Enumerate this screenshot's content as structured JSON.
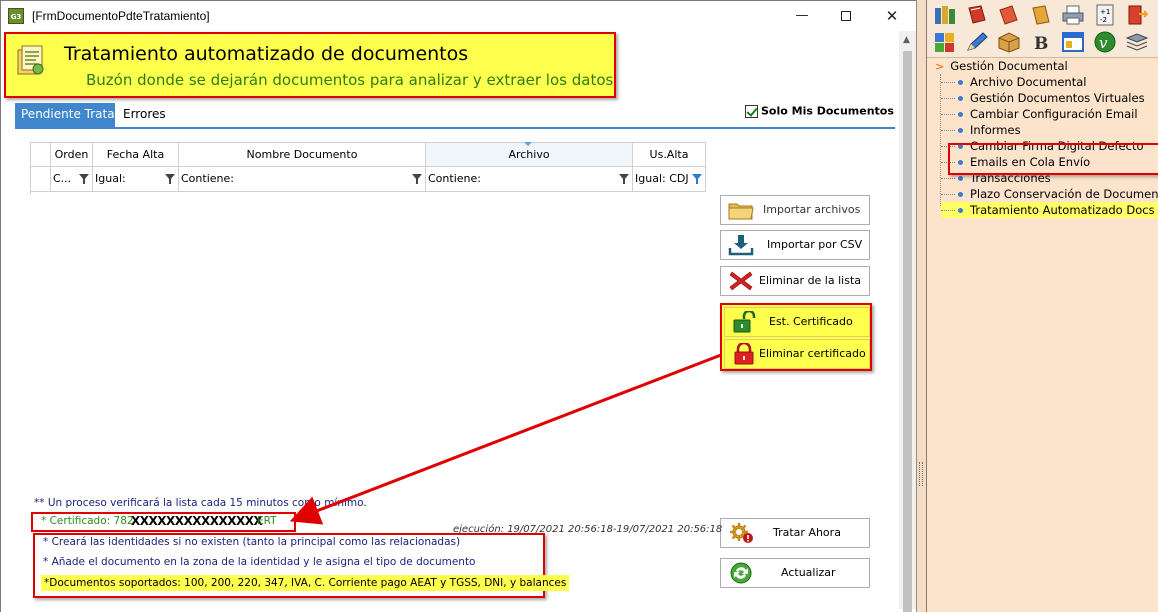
{
  "window": {
    "app_icon_text": "G3",
    "title": "[FrmDocumentoPdteTratamiento]",
    "min_glyph": "—",
    "close_glyph": "✕"
  },
  "banner": {
    "icon": "document-inbox-icon",
    "title": "Tratamiento automatizado de documentos",
    "subtitle": "Buzón donde se dejarán documentos para analizar y extraer los datos"
  },
  "tabs": [
    {
      "label": "Pendiente Tratar",
      "active": true
    },
    {
      "label": "Errores",
      "active": false
    }
  ],
  "only_mine": {
    "label": "Solo Mis Documentos",
    "checked": true
  },
  "grid": {
    "columns": [
      {
        "header": "",
        "filter": ""
      },
      {
        "header": "Orden",
        "filter": "C..."
      },
      {
        "header": "Fecha Alta",
        "filter": "Igual:"
      },
      {
        "header": "Nombre Documento",
        "filter": "Contiene:"
      },
      {
        "header": "Archivo",
        "filter": "Contiene:"
      },
      {
        "header": "Us.Alta",
        "filter": "Igual: CDJ"
      }
    ]
  },
  "actions": {
    "import_files": "Importar archivos",
    "import_csv": "Importar por CSV",
    "delete_from_list": "Eliminar de la lista",
    "cert_status": "Est. Certificado",
    "delete_cert": "Eliminar certificado",
    "process_now": "Tratar Ahora",
    "refresh": "Actualizar"
  },
  "info": {
    "process_note": "** Un proceso verificará la lista cada 15 minutos como mínimo.",
    "cert_prefix": "* Certificado: 782",
    "cert_mask": "XXXXXXXXXXXXXXX",
    "cert_suffix": "ERT",
    "exec_time": "ejecución: 19/07/2021 20:56:18-19/07/2021 20:56:18",
    "note_identities": "* Creará las identidades si no existen (tanto la principal como las relacionadas)",
    "note_add_doc": "* Añade el documento en la zona de la identidad y le asigna el tipo de documento",
    "note_supported": "*Documentos soportados: 100, 200, 220, 347, IVA, C. Corriente pago AEAT y TGSS, DNI, y balances"
  },
  "nav": {
    "root": "Gestión Documental",
    "items": [
      {
        "label": "Archivo Documental"
      },
      {
        "label": "Gestión Documentos Virtuales"
      },
      {
        "label": "Cambiar Configuración Email"
      },
      {
        "label": "Informes"
      },
      {
        "label": "Cambiar Firma Digital Defecto"
      },
      {
        "label": "Emails en Cola Envío"
      },
      {
        "label": "Transacciones"
      },
      {
        "label": "Plazo Conservación de Documentos"
      },
      {
        "label": "Tratamiento Automatizado Docs",
        "selected": true
      }
    ],
    "toolbar_icons": [
      "books-icon",
      "book-red-icon",
      "notes-icon",
      "notebook-icon",
      "printer-icon",
      "calculator-icon",
      "exit-door-icon",
      "puzzle-icon",
      "pencil-icon",
      "box-icon",
      "b-letter-icon",
      "window-icon",
      "v-circle-icon",
      "stack-icon"
    ]
  },
  "colors": {
    "highlight_yellow": "#ffff4d",
    "annotation_red": "#e00000",
    "tab_blue": "#3f86cc",
    "nav_background": "#fbe3cc"
  }
}
